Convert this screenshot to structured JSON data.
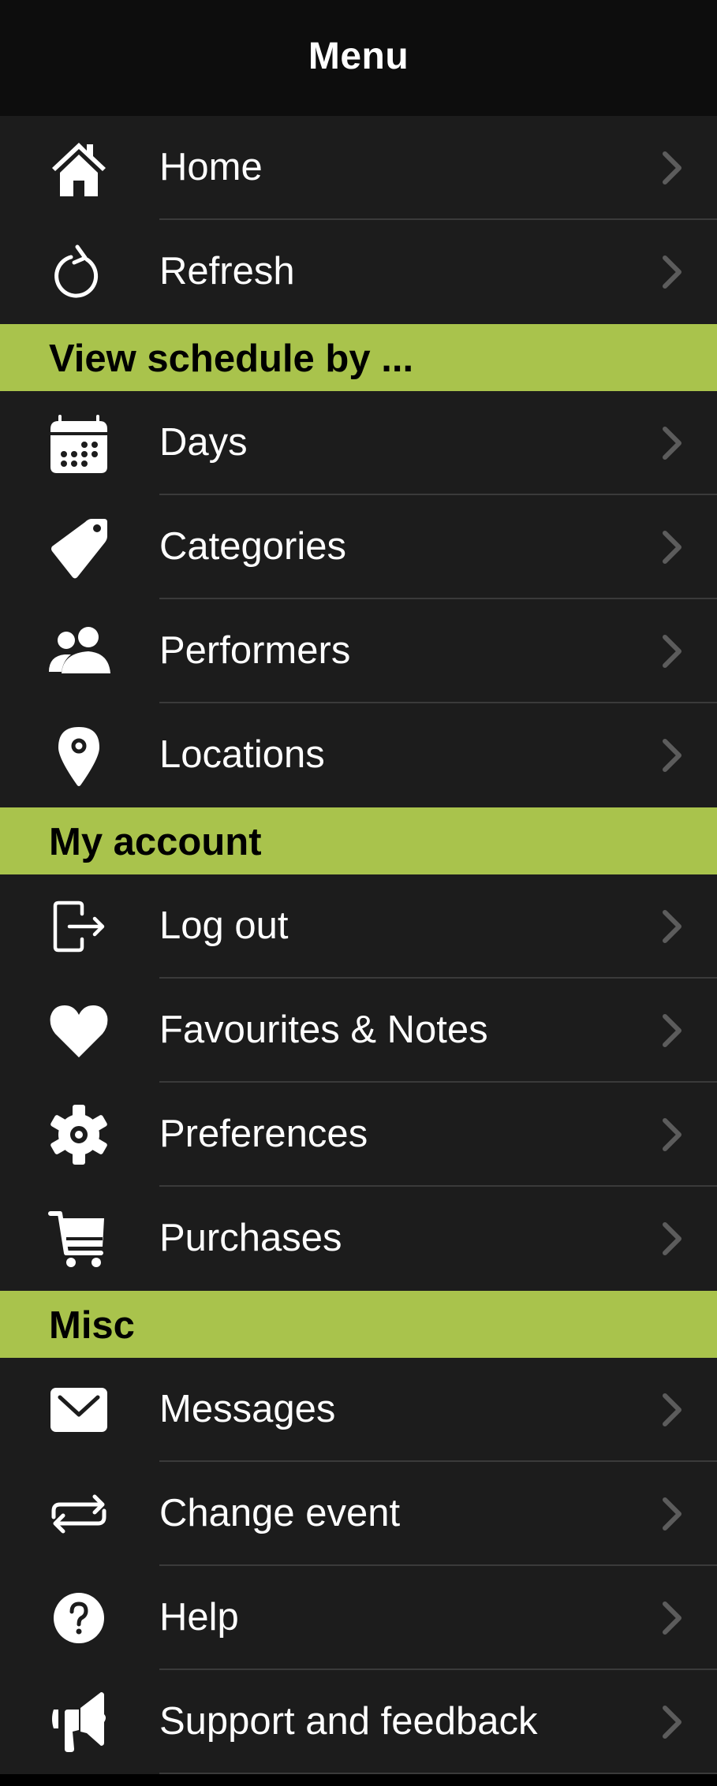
{
  "header": {
    "title": "Menu"
  },
  "colors": {
    "header_bg": "#0d0d0d",
    "row_bg": "#1c1c1c",
    "section_bg": "#a9c34c",
    "separator": "#3a3a3a",
    "chevron": "#5c5c5c",
    "text": "#ffffff"
  },
  "groups": [
    {
      "section": null,
      "items": [
        {
          "label": "Home",
          "icon": "home-icon"
        },
        {
          "label": "Refresh",
          "icon": "refresh-icon"
        }
      ]
    },
    {
      "section": "View schedule by ...",
      "items": [
        {
          "label": "Days",
          "icon": "calendar-icon"
        },
        {
          "label": "Categories",
          "icon": "tag-icon"
        },
        {
          "label": "Performers",
          "icon": "users-icon"
        },
        {
          "label": "Locations",
          "icon": "map-pin-icon"
        }
      ]
    },
    {
      "section": "My account",
      "items": [
        {
          "label": "Log out",
          "icon": "logout-icon"
        },
        {
          "label": "Favourites & Notes",
          "icon": "heart-icon"
        },
        {
          "label": "Preferences",
          "icon": "gear-icon"
        },
        {
          "label": "Purchases",
          "icon": "cart-icon"
        }
      ]
    },
    {
      "section": "Misc",
      "items": [
        {
          "label": "Messages",
          "icon": "envelope-icon"
        },
        {
          "label": "Change event",
          "icon": "swap-icon"
        },
        {
          "label": "Help",
          "icon": "help-icon"
        },
        {
          "label": "Support and feedback",
          "icon": "megaphone-icon"
        }
      ]
    }
  ]
}
